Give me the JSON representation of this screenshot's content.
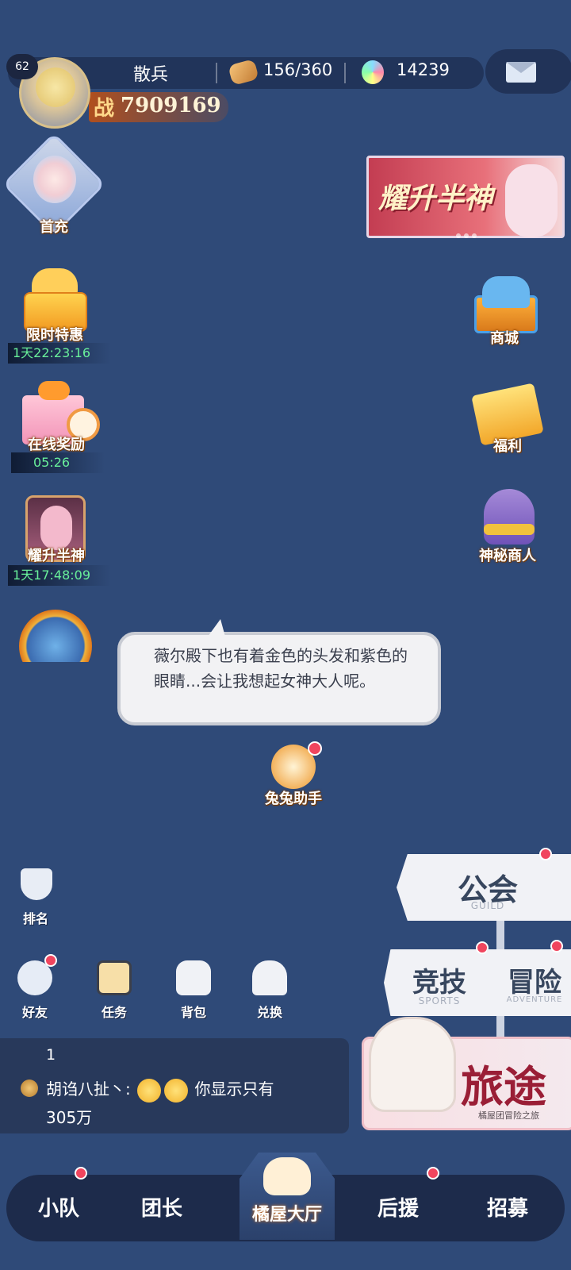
{
  "top": {
    "level": "62",
    "player_name": "散兵",
    "stamina": "156/360",
    "gems": "14239",
    "power_label": "战",
    "power_value": "7909169"
  },
  "left_icons": {
    "first_charge": "首充",
    "limited_offer": "限时特惠",
    "limited_offer_timer": "1天22:23:16",
    "online_reward": "在线奖励",
    "online_reward_timer": "05:26",
    "ascend": "耀升半神",
    "ascend_timer": "1天17:48:09"
  },
  "right_icons": {
    "banner_text": "耀升半神",
    "shop": "商城",
    "welfare": "福利",
    "mystery": "神秘商人"
  },
  "bubble": {
    "text": "薇尔殿下也有着金色的头发和紫色的眼睛...会让我想起女神大人呢。"
  },
  "assistant": {
    "label": "兔兔助手"
  },
  "side_buttons": {
    "ranking": "排名",
    "friends": "好友",
    "tasks": "任务",
    "bag": "背包",
    "exchange": "兑换"
  },
  "chat": {
    "number": "1",
    "name": "胡诌八扯丶:",
    "message": "你显示只有",
    "message2": "305万"
  },
  "signs": {
    "guild": "公会",
    "guild_sub": "GUILD",
    "arena": "竞技",
    "arena_sub": "SPORTS",
    "adventure": "冒险",
    "adventure_sub": "ADVENTURE",
    "journey": "旅途",
    "journey_sub": "橘屋团冒险之旅"
  },
  "nav": {
    "team": "小队",
    "leader": "团长",
    "hall": "橘屋大厅",
    "support": "后援",
    "recruit": "招募"
  },
  "colors": {
    "background": "#2f4a78",
    "timer_green": "#69f09a",
    "notification_red": "#f0455e"
  }
}
